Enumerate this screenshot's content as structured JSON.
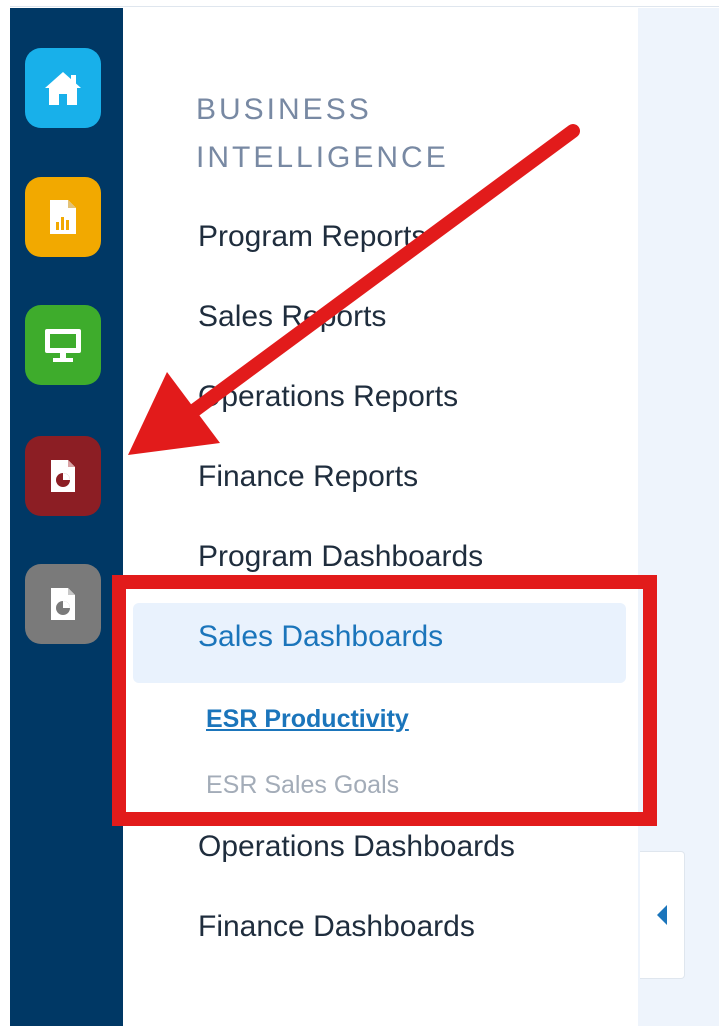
{
  "sidebar": {
    "buttons": [
      {
        "icon": "home-icon",
        "color": "#18b0ea"
      },
      {
        "icon": "bar-report-icon",
        "color": "#f2a900"
      },
      {
        "icon": "monitor-icon",
        "color": "#3eac2c"
      },
      {
        "icon": "pie-document-icon",
        "color": "#8c1e24"
      },
      {
        "icon": "pie-document-icon",
        "color": "#7a7a7a"
      }
    ]
  },
  "menu": {
    "heading": "BUSINESS INTELLIGENCE",
    "items": [
      {
        "label": "Program Reports"
      },
      {
        "label": "Sales Reports"
      },
      {
        "label": "Operations Reports"
      },
      {
        "label": "Finance Reports"
      },
      {
        "label": "Program Dashboards"
      },
      {
        "label": "Sales Dashboards",
        "active": true,
        "subitems": [
          {
            "label": "ESR Productivity",
            "current": true
          },
          {
            "label": "ESR Sales Goals"
          }
        ]
      },
      {
        "label": "Operations Dashboards"
      },
      {
        "label": "Finance Dashboards"
      }
    ]
  },
  "colors": {
    "rail": "#003865",
    "accent": "#1b75bb",
    "annotation": "#e21b1b",
    "content_bg": "#eef4fc"
  },
  "collapse_icon": "chevron-left-icon"
}
